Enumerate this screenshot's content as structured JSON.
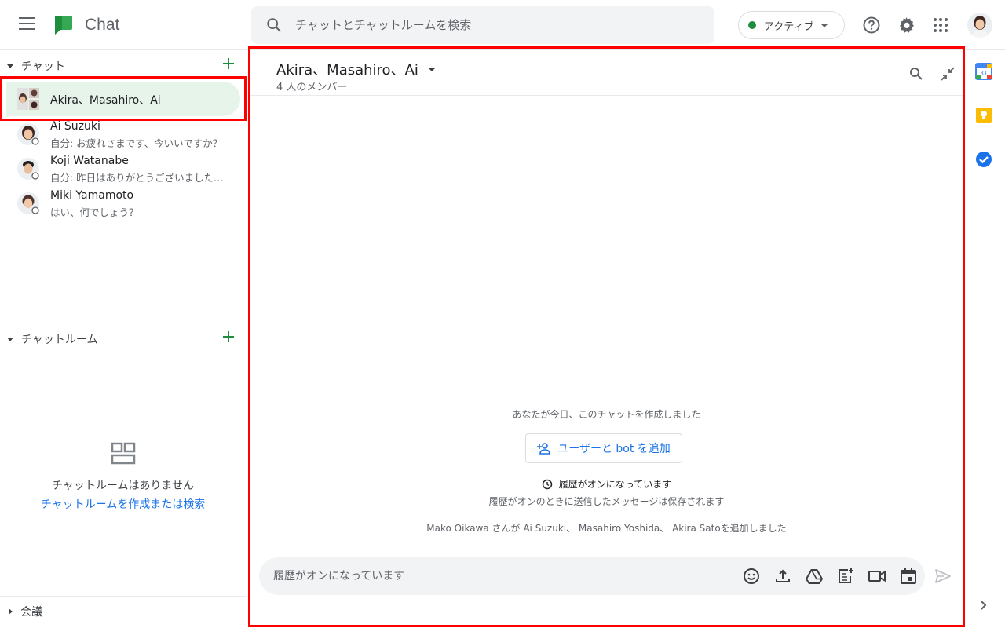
{
  "app": {
    "name": "Chat"
  },
  "search": {
    "placeholder": "チャットとチャットルームを検索"
  },
  "status": {
    "label": "アクティブ",
    "color": "#1e8e3e"
  },
  "sidebar": {
    "chats_header": "チャット",
    "chats": [
      {
        "name": "Akira、Masahiro、Ai",
        "preview": ""
      },
      {
        "name": "Ai Suzuki",
        "preview": "自分: お疲れさまです、今いいですか？"
      },
      {
        "name": "Koji Watanabe",
        "preview": "自分: 昨日はありがとうございました..."
      },
      {
        "name": "Miki Yamamoto",
        "preview": "はい、何でしょう？"
      }
    ],
    "rooms_header": "チャットルーム",
    "rooms_empty_title": "チャットルームはありません",
    "rooms_empty_link": "チャットルームを作成または検索",
    "meetings_header": "会議"
  },
  "conversation": {
    "title": "Akira、Masahiro、Ai",
    "member_count": "4 人のメンバー",
    "created_notice": "あなたが今日、このチャットを作成しました",
    "add_button": "ユーザーと bot を追加",
    "history_title": "履歴がオンになっています",
    "history_desc": "履歴がオンのときに送信したメッセージは保存されます",
    "added_notice": "Mako Oikawa さんが Ai Suzuki、 Masahiro Yoshida、 Akira Satoを追加しました",
    "composer_placeholder": "履歴がオンになっています"
  },
  "colors": {
    "accent": "#1a73e8",
    "brand_green": "#34a853",
    "highlight": "#ff0000"
  }
}
